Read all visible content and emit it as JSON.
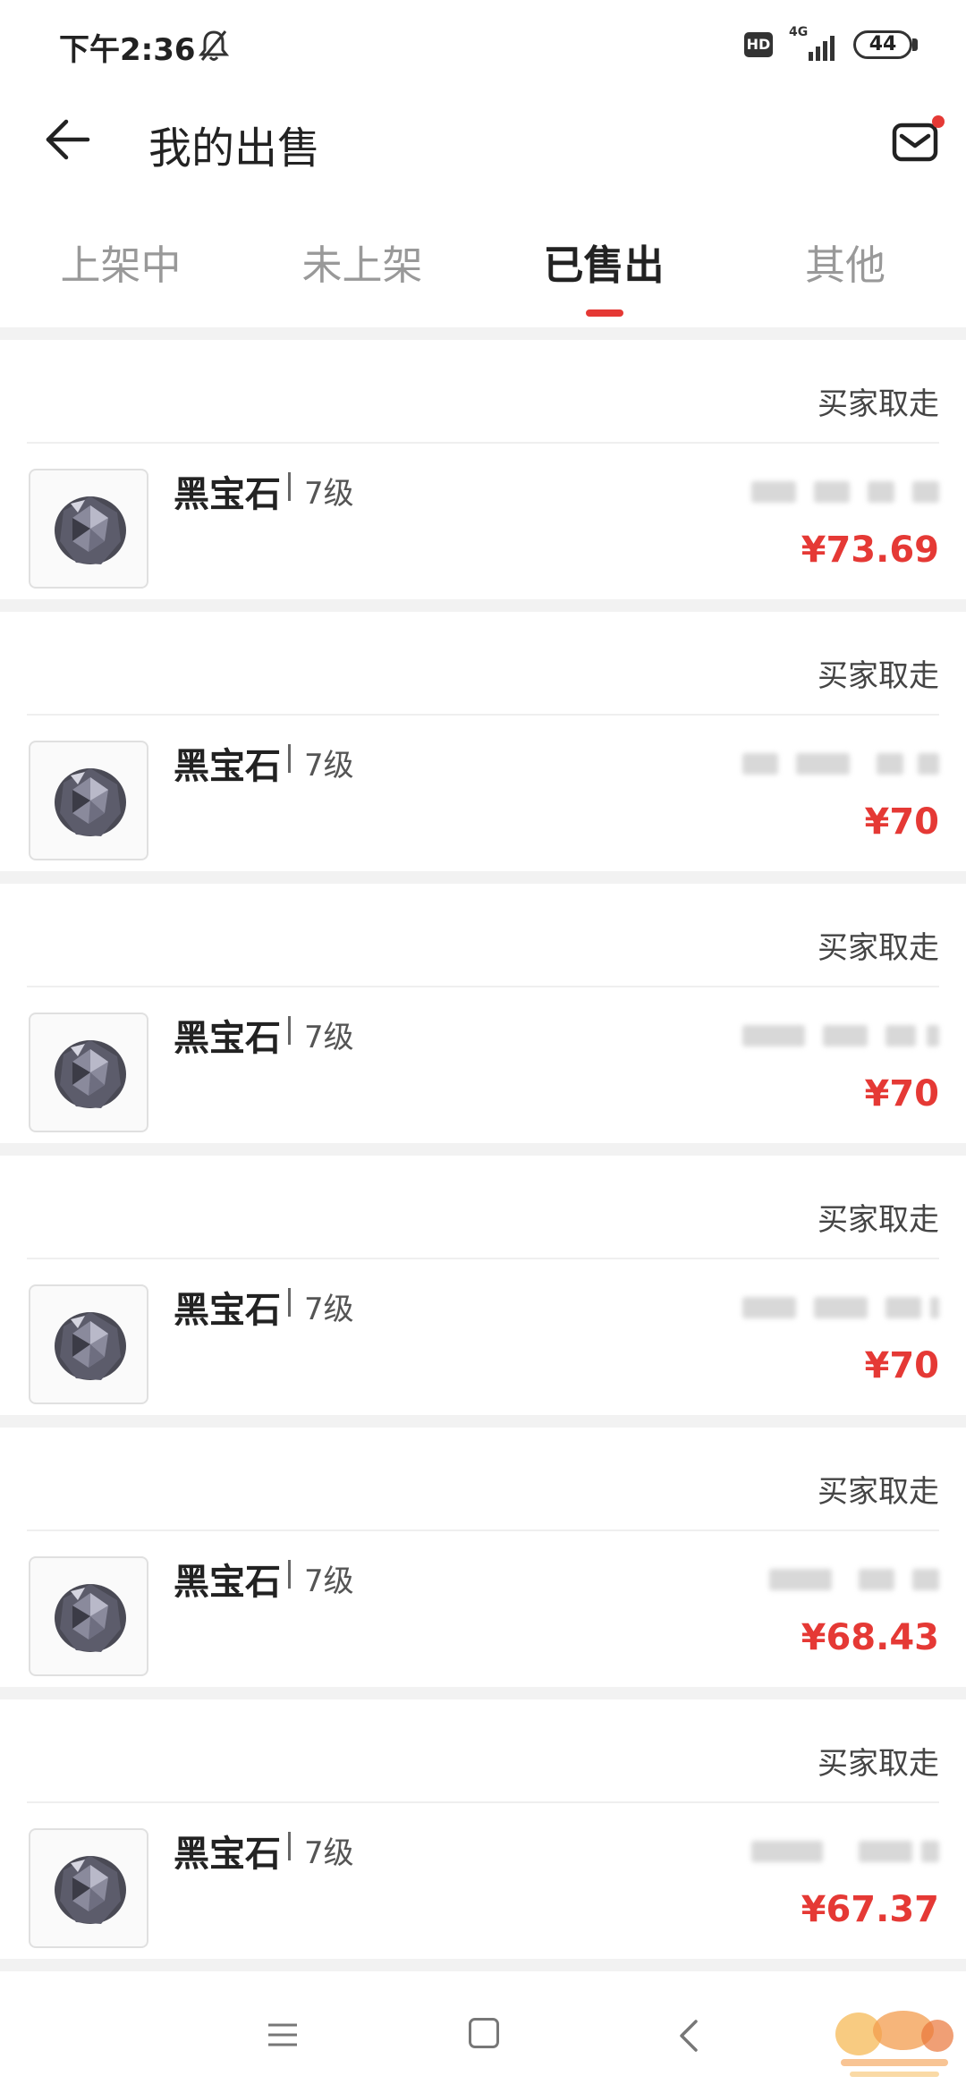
{
  "status_bar": {
    "time": "下午2:36",
    "hd_badge": "HD",
    "network": "4G",
    "battery": "44"
  },
  "header": {
    "title": "我的出售"
  },
  "tabs": [
    {
      "label": "上架中",
      "active": false
    },
    {
      "label": "未上架",
      "active": false
    },
    {
      "label": "已售出",
      "active": true
    },
    {
      "label": "其他",
      "active": false
    }
  ],
  "orders": [
    {
      "status": "买家取走",
      "name": "黑宝石",
      "level": "7级",
      "price": "¥73.69"
    },
    {
      "status": "买家取走",
      "name": "黑宝石",
      "level": "7级",
      "price": "¥70"
    },
    {
      "status": "买家取走",
      "name": "黑宝石",
      "level": "7级",
      "price": "¥70"
    },
    {
      "status": "买家取走",
      "name": "黑宝石",
      "level": "7级",
      "price": "¥70"
    },
    {
      "status": "买家取走",
      "name": "黑宝石",
      "level": "7级",
      "price": "¥68.43"
    },
    {
      "status": "买家取走",
      "name": "黑宝石",
      "level": "7级",
      "price": "¥67.37"
    }
  ],
  "colors": {
    "accent": "#e53935",
    "separator": "#f2f2f2"
  },
  "icons": {
    "back": "arrow-left-icon",
    "mail": "mail-icon",
    "mute": "bell-off-icon",
    "gem": "gem-icon"
  }
}
